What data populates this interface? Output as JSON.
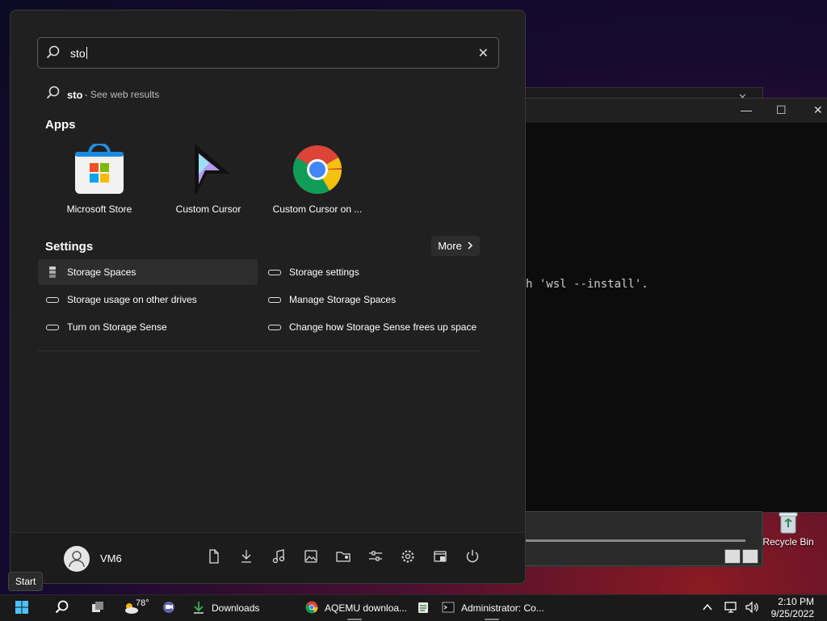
{
  "search": {
    "value": "sto",
    "web_query": "sto",
    "web_suffix": "- See web results"
  },
  "sections": {
    "apps": "Apps",
    "settings": "Settings",
    "more": "More"
  },
  "apps": [
    {
      "name": "Microsoft Store"
    },
    {
      "name": "Custom Cursor"
    },
    {
      "name": "Custom Cursor on ..."
    }
  ],
  "settings": [
    {
      "label": "Storage Spaces"
    },
    {
      "label": "Storage settings"
    },
    {
      "label": "Storage usage on other drives"
    },
    {
      "label": "Manage Storage Spaces"
    },
    {
      "label": "Turn on Storage Sense"
    },
    {
      "label": "Change how Storage Sense frees up space"
    }
  ],
  "user": {
    "name": "VM6"
  },
  "tooltip": "Start",
  "terminal": {
    "text": "h 'wsl --install'."
  },
  "desktop": {
    "recycle_bin": "Recycle Bin"
  },
  "taskbar": {
    "weather": "78°",
    "downloads": "Downloads",
    "chrome": "AQEMU downloa...",
    "admin": "Administrator: Co...",
    "time": "2:10 PM",
    "date": "9/25/2022"
  }
}
